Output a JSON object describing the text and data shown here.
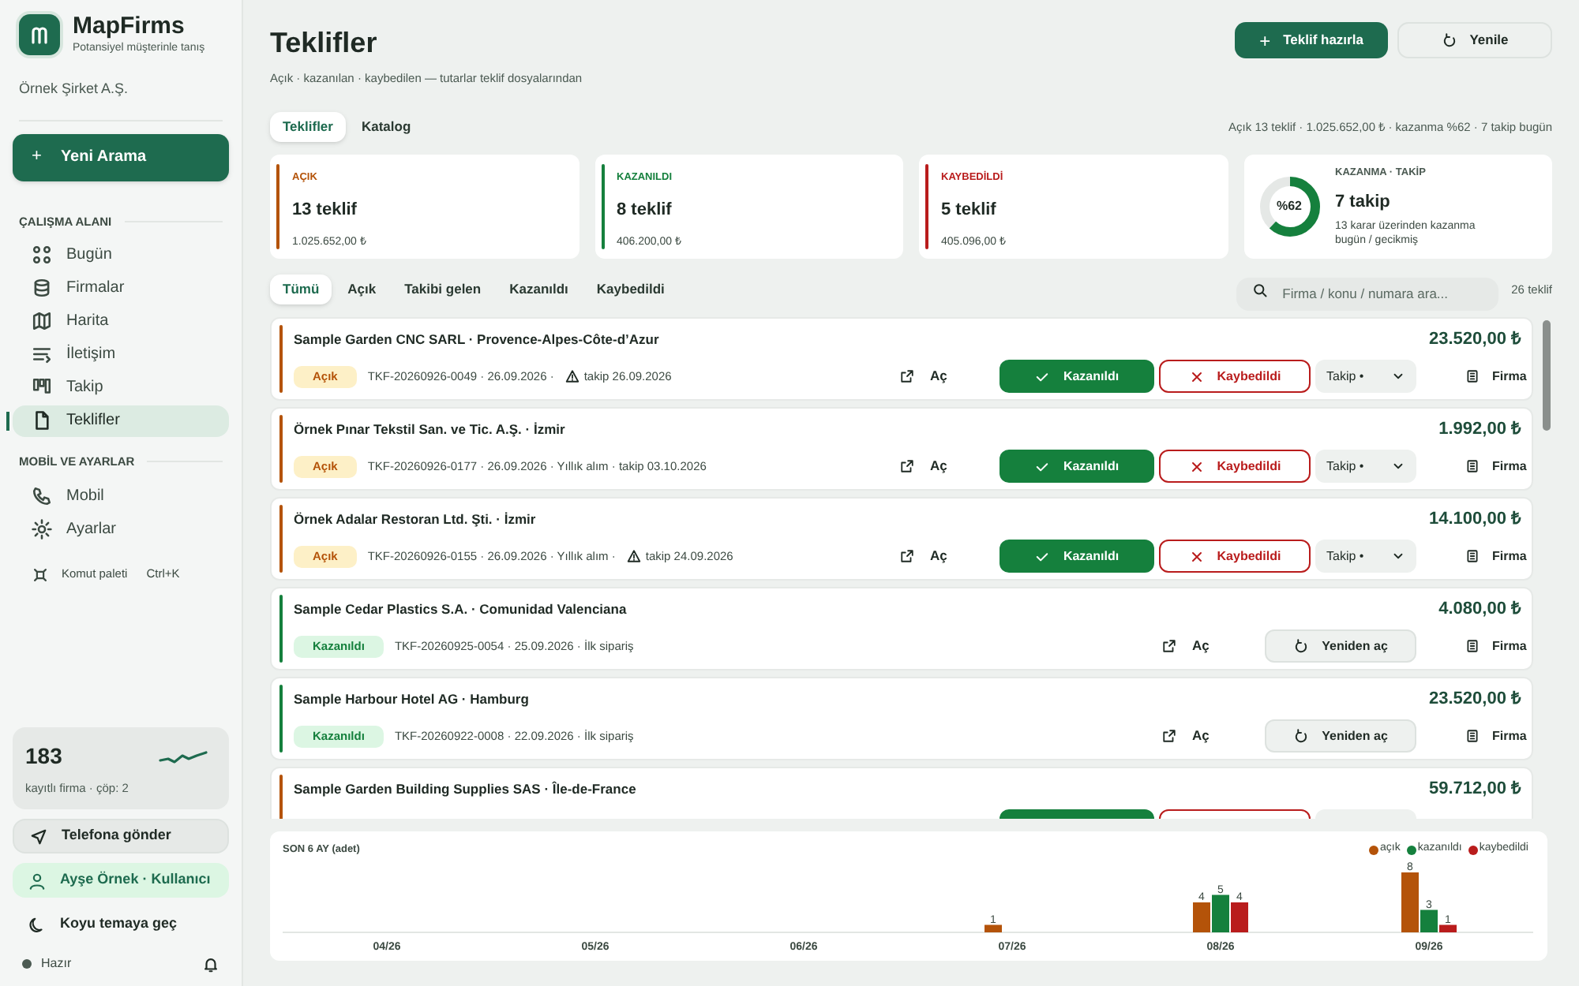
{
  "app": {
    "name": "MapFirms",
    "tagline": "Potansiyel müşterinle tanış",
    "company": "Örnek Şirket A.Ş."
  },
  "new_search": "Yeni Arama",
  "new_search_icon": "+",
  "sidebar": {
    "sections": [
      {
        "title": "ÇALIŞMA ALANI",
        "items": [
          {
            "label": "Bugün",
            "selected": false
          },
          {
            "label": "Firmalar",
            "selected": false
          },
          {
            "label": "Harita",
            "selected": false
          },
          {
            "label": "İletişim",
            "selected": false
          },
          {
            "label": "Takip",
            "selected": false
          },
          {
            "label": "Teklifler",
            "selected": true
          }
        ]
      },
      {
        "title": "MOBİL VE AYARLAR",
        "items": [
          {
            "label": "Mobil",
            "selected": false
          },
          {
            "label": "Ayarlar",
            "selected": false
          }
        ]
      }
    ],
    "command": {
      "label": "Komut paleti",
      "shortcut": "Ctrl+K"
    },
    "stats": {
      "count": "183",
      "caption": "kayıtlı firma · çöp: 2"
    },
    "buttons": [
      {
        "kind": "send",
        "label": "Telefona gönder"
      },
      {
        "kind": "user",
        "label": "Ayşe Örnek · Kullanıcı"
      },
      {
        "kind": "theme",
        "label": "Koyu temaya geç"
      }
    ],
    "status": "Hazır"
  },
  "header": {
    "title": "Teklifler",
    "subtitle": "Açık · kazanılan · kaybedilen — tutarlar teklif dosyalarından",
    "primary_button": "Teklif hazırla",
    "primary_icon": "+",
    "secondary_button": "Yenile"
  },
  "tabs": [
    {
      "label": "Teklifler",
      "selected": true
    },
    {
      "label": "Katalog",
      "selected": false
    }
  ],
  "summary": "Açık 13 teklif · 1.025.652,00 ₺ · kazanma %62 · 7 takip bugün",
  "cards": [
    {
      "label": "AÇIK",
      "value": "13 teklif",
      "amount": "1.025.652,00 ₺",
      "color": "#b45309"
    },
    {
      "label": "KAZANILDI",
      "value": "8 teklif",
      "amount": "406.200,00 ₺",
      "color": "#15803d"
    },
    {
      "label": "KAYBEDİLDİ",
      "value": "5 teklif",
      "amount": "405.096,00 ₺",
      "color": "#b91c1c"
    }
  ],
  "win_card": {
    "label": "KAZANMA · TAKİP",
    "percent": "%62",
    "level": 0.62,
    "value": "7 takip",
    "note": "13 karar üzerinden kazanma bugün / gecikmiş"
  },
  "filters": [
    {
      "label": "Tümü",
      "selected": true
    },
    {
      "label": "Açık",
      "selected": false
    },
    {
      "label": "Takibi gelen",
      "selected": false
    },
    {
      "label": "Kazanıldı",
      "selected": false
    },
    {
      "label": "Kaybedildi",
      "selected": false
    }
  ],
  "search": {
    "placeholder": "Firma / konu / numara ara..."
  },
  "count": "26 teklif",
  "rows": [
    {
      "kind": "open",
      "company": "Sample Garden CNC SARL · Provence-Alpes-Côte-d’Azur",
      "amount": "23.520,00 ₺",
      "badge": "Açık",
      "meta": "TKF-20260926-0049 · 26.09.2026 ·",
      "warning": true,
      "followup": "takip 26.09.2026",
      "open": "Aç",
      "won": "Kazanıldı",
      "lost": "Kaybedildi",
      "select": "Takip •",
      "firm": "Firma"
    },
    {
      "kind": "open",
      "company": "Örnek Pınar Tekstil San. ve Tic. A.Ş. · İzmir",
      "amount": "1.992,00 ₺",
      "badge": "Açık",
      "meta": "TKF-20260926-0177 · 26.09.2026 · Yıllık alım · takip 03.10.2026",
      "warning": false,
      "open": "Aç",
      "won": "Kazanıldı",
      "lost": "Kaybedildi",
      "select": "Takip •",
      "firm": "Firma"
    },
    {
      "kind": "open",
      "company": "Örnek Adalar Restoran Ltd. Şti. · İzmir",
      "amount": "14.100,00 ₺",
      "badge": "Açık",
      "meta": "TKF-20260926-0155 · 26.09.2026 · Yıllık alım ·",
      "warning": true,
      "followup": "takip 24.09.2026",
      "open": "Aç",
      "won": "Kazanıldı",
      "lost": "Kaybedildi",
      "select": "Takip •",
      "firm": "Firma"
    },
    {
      "kind": "won",
      "company": "Sample Cedar Plastics S.A. · Comunidad Valenciana",
      "amount": "4.080,00 ₺",
      "badge": "Kazanıldı",
      "meta": "TKF-20260925-0054 · 25.09.2026 · İlk sipariş",
      "warning": false,
      "open": "Aç",
      "reopen": "Yeniden aç",
      "firm": "Firma"
    },
    {
      "kind": "won",
      "company": "Sample Harbour Hotel AG · Hamburg",
      "amount": "23.520,00 ₺",
      "badge": "Kazanıldı",
      "meta": "TKF-20260922-0008 · 22.09.2026 · İlk sipariş",
      "warning": false,
      "open": "Aç",
      "reopen": "Yeniden aç",
      "firm": "Firma"
    },
    {
      "kind": "open",
      "company": "Sample Garden Building Supplies SAS · Île-de-France",
      "amount": "59.712,00 ₺",
      "warning": false
    }
  ],
  "chart": {
    "chart_data": {
      "type": "bar",
      "title": "SON 6 AY (adet)",
      "legend": true,
      "categories": [
        "04/26",
        "05/26",
        "06/26",
        "07/26",
        "08/26",
        "09/26"
      ],
      "ylim": [
        0,
        8
      ],
      "data_labels": true,
      "series": [
        {
          "name": "açık",
          "color": "#b45309",
          "values": [
            null,
            null,
            null,
            1,
            4,
            8
          ]
        },
        {
          "name": "kazanıldı",
          "color": "#15803d",
          "values": [
            null,
            null,
            null,
            null,
            5,
            3
          ]
        },
        {
          "name": "kaybedildi",
          "color": "#b91c1c",
          "values": [
            null,
            null,
            null,
            null,
            4,
            1
          ]
        }
      ]
    }
  }
}
